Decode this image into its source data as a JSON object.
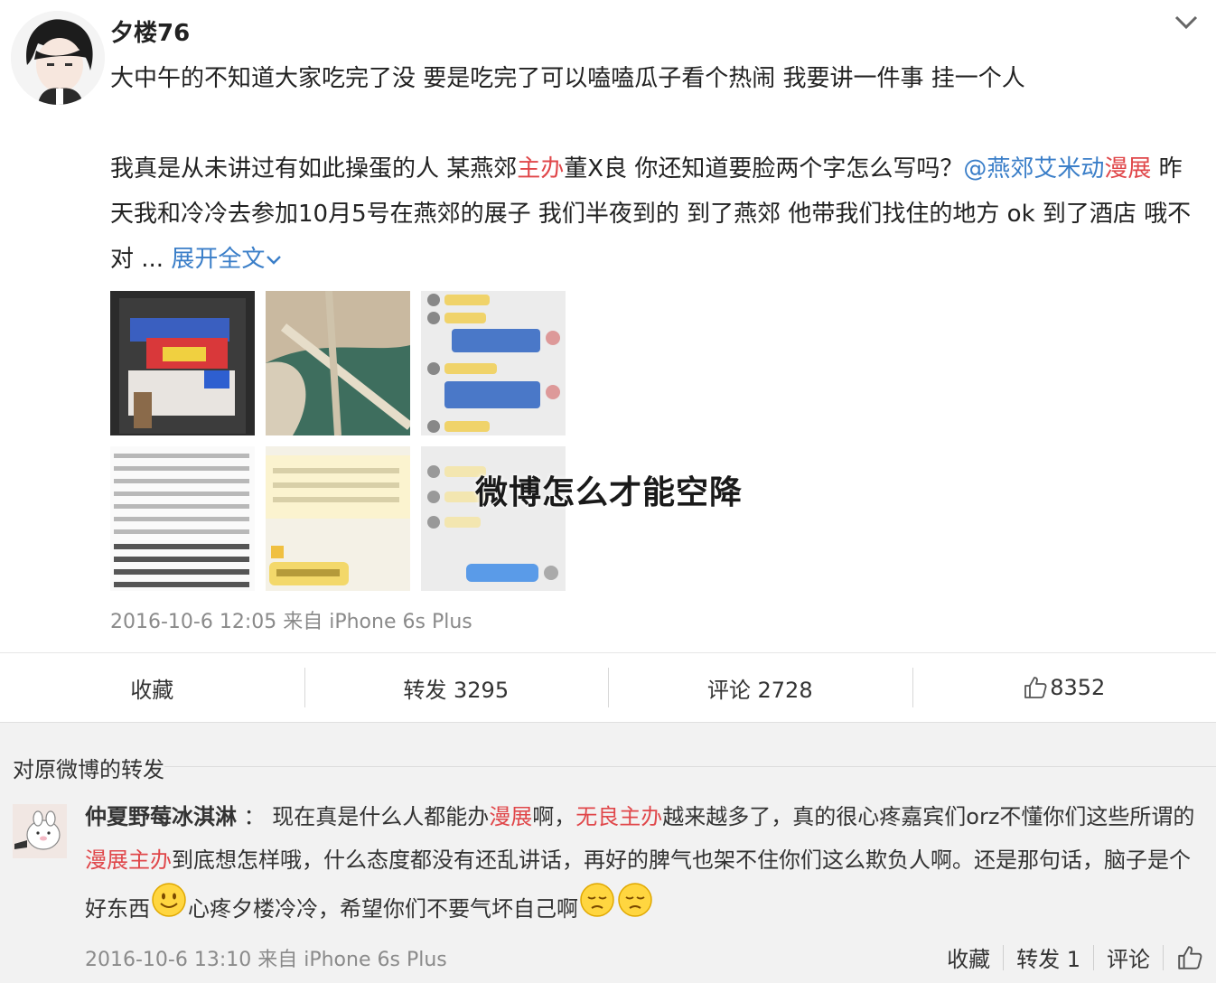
{
  "post": {
    "author": "夕楼76",
    "line1": "大中午的不知道大家吃完了没 要是吃完了可以嗑嗑瓜子看个热闹 我要讲一件事 挂一个人",
    "p2_a": "我真是从未讲过有如此操蛋的人 某燕郊",
    "p2_red1": "主办",
    "p2_b": "董X良 你还知道要脸两个字怎么写吗？",
    "p2_mention": "@燕郊艾米动",
    "p2_red2": "漫展",
    "p2_c": " 昨天我和冷冷去参加10月5号在燕郊的展子 我们半夜到的 到了燕郊 他带我们找住的地方 ok 到了酒店 哦不对 ... ",
    "expand": "展开全文",
    "meta": "2016-10-6 12:05 来自 iPhone 6s Plus",
    "watermark": "微博怎么才能空降"
  },
  "actions": {
    "favorite": "收藏",
    "repost": "转发 3295",
    "comment": "评论 2728",
    "like": "8352"
  },
  "repost_section": {
    "title": "对原微博的转发",
    "comment": {
      "author": "仲夏野莓冰淇淋",
      "sep": " ： ",
      "t1": "现在真是什么人都能办",
      "r1": "漫展",
      "t2": "啊，",
      "r2": "无良主办",
      "t3": "越来越多了，真的很心疼嘉宾们orz不懂你们这些所谓的",
      "r3": "漫展主办",
      "t4": "到底想怎样哦，什么态度都没有还乱讲话，再好的脾气也架不住你们这么欺负人啊。还是那句话，脑子是个好东西",
      "t5": "心疼夕楼冷冷，希望你们不要气坏自己啊",
      "meta": "2016-10-6 13:10 来自 iPhone 6s Plus",
      "favorite": "收藏",
      "repost": "转发 1",
      "comment_label": "评论"
    }
  },
  "colors": {
    "link_blue": "#3a7ec8",
    "highlight_red": "#e0474a",
    "meta_gray": "#8a8a8a"
  },
  "icons": [
    "chevron-down-icon",
    "thumbs-up-icon",
    "smile-emoji-icon",
    "sad-emoji-icon"
  ]
}
